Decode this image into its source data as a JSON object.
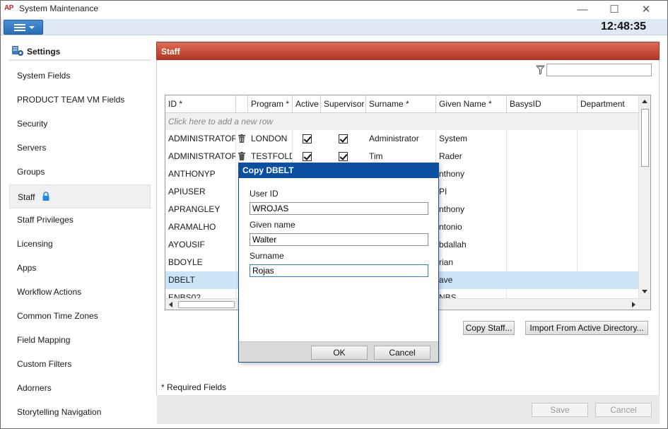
{
  "window": {
    "logo": "AP",
    "title": "System Maintenance",
    "clock": "12:48:35",
    "controls": {
      "minimize": "—",
      "maximize": "☐",
      "close": "✕"
    }
  },
  "nav": {
    "header": "Settings",
    "items": [
      {
        "label": "System Fields"
      },
      {
        "label": "PRODUCT TEAM VM Fields"
      },
      {
        "label": "Security"
      },
      {
        "label": "Servers"
      },
      {
        "label": "Groups"
      },
      {
        "label": "Staff",
        "selected": true
      },
      {
        "label": "Staff Privileges"
      },
      {
        "label": "Licensing"
      },
      {
        "label": "Apps"
      },
      {
        "label": "Workflow Actions"
      },
      {
        "label": "Common Time Zones"
      },
      {
        "label": "Field Mapping"
      },
      {
        "label": "Custom Filters"
      },
      {
        "label": "Adorners"
      },
      {
        "label": "Storytelling Navigation"
      }
    ]
  },
  "panel": {
    "title": "Staff",
    "filter_value": "",
    "grid": {
      "columns": [
        "ID *",
        "",
        "Program *",
        "Active",
        "Supervisor",
        "Surname *",
        "Given Name *",
        "BasysID",
        "Department"
      ],
      "new_row_text": "Click here to add a new row",
      "rows": [
        {
          "id": "ADMINISTRATOR",
          "program": "LONDON",
          "active": true,
          "supervisor": true,
          "surname": "Administrator",
          "given": "System",
          "selected": false
        },
        {
          "id": "ADMINISTRATOR",
          "program": "TESTFOLD",
          "active": true,
          "supervisor": true,
          "surname": "Tim",
          "given": "Rader",
          "selected": false
        },
        {
          "id": "ANTHONYP",
          "program": "",
          "active": null,
          "supervisor": null,
          "surname": "",
          "given": "nthony",
          "selected": false
        },
        {
          "id": "APIUSER",
          "program": "",
          "active": null,
          "supervisor": null,
          "surname": "",
          "given": "PI",
          "selected": false
        },
        {
          "id": "APRANGLEY",
          "program": "",
          "active": null,
          "supervisor": null,
          "surname": "",
          "given": "nthony",
          "selected": false
        },
        {
          "id": "ARAMALHO",
          "program": "",
          "active": null,
          "supervisor": null,
          "surname": "",
          "given": "ntonio",
          "selected": false
        },
        {
          "id": "AYOUSIF",
          "program": "",
          "active": null,
          "supervisor": null,
          "surname": "",
          "given": "bdallah",
          "selected": false
        },
        {
          "id": "BDOYLE",
          "program": "",
          "active": null,
          "supervisor": null,
          "surname": "",
          "given": "rian",
          "selected": false
        },
        {
          "id": "DBELT",
          "program": "",
          "active": null,
          "supervisor": null,
          "surname": "",
          "given": "ave",
          "selected": true
        },
        {
          "id": "ENBS02",
          "program": "",
          "active": null,
          "supervisor": null,
          "surname": "",
          "given": "NBS",
          "selected": false
        }
      ]
    },
    "buttons": {
      "copy_staff": "Copy Staff...",
      "import_ad": "Import From Active Directory...",
      "save": "Save",
      "cancel": "Cancel"
    },
    "required_note": "* Required Fields"
  },
  "dialog": {
    "title": "Copy DBELT",
    "fields": [
      {
        "label": "User ID",
        "value": "WROJAS"
      },
      {
        "label": "Given name",
        "value": "Walter"
      },
      {
        "label": "Surname",
        "value": "Rojas"
      }
    ],
    "ok": "OK",
    "cancel": "Cancel"
  },
  "colors": {
    "panel_header": "#c0402c",
    "dialog_title": "#0b4fa3",
    "selection": "#cce4f7",
    "menu_button": "#2a6cb8"
  }
}
